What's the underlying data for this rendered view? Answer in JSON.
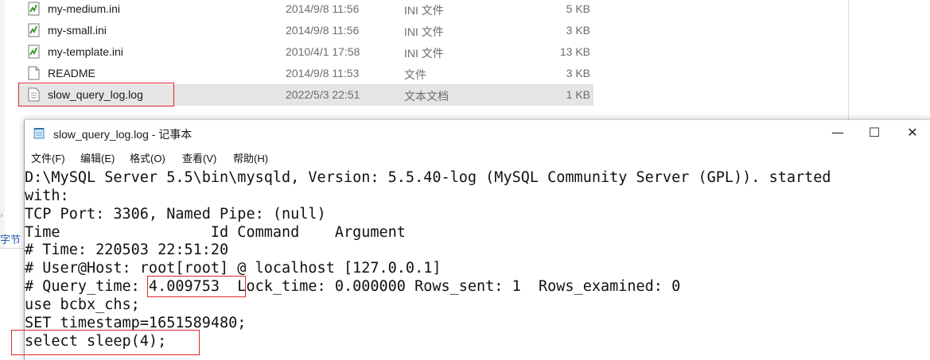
{
  "explorer": {
    "files": [
      {
        "name": "my-medium.ini",
        "date": "2014/9/8 11:56",
        "type": "INI 文件",
        "size": "5 KB",
        "icon": "ini-file-icon"
      },
      {
        "name": "my-small.ini",
        "date": "2014/9/8 11:56",
        "type": "INI 文件",
        "size": "3 KB",
        "icon": "ini-file-icon"
      },
      {
        "name": "my-template.ini",
        "date": "2010/4/1 17:58",
        "type": "INI 文件",
        "size": "13 KB",
        "icon": "ini-file-icon"
      },
      {
        "name": "README",
        "date": "2014/9/8 11:53",
        "type": "文件",
        "size": "3 KB",
        "icon": "file-icon"
      },
      {
        "name": "slow_query_log.log",
        "date": "2022/5/3 22:51",
        "type": "文本文档",
        "size": "1 KB",
        "icon": "text-file-icon"
      }
    ],
    "side_label": "字节"
  },
  "notepad": {
    "title": "slow_query_log.log - 记事本",
    "menu": [
      "文件(F)",
      "编辑(E)",
      "格式(O)",
      "查看(V)",
      "帮助(H)"
    ],
    "window_buttons": {
      "minimize": "—",
      "maximize": "☐",
      "close": "✕"
    },
    "lines": [
      "D:\\MySQL Server 5.5\\bin\\mysqld, Version: 5.5.40-log (MySQL Community Server (GPL)). started",
      "with:",
      "TCP Port: 3306, Named Pipe: (null)",
      "Time                 Id Command    Argument",
      "# Time: 220503 22:51:20",
      "# User@Host: root[root] @ localhost [127.0.0.1]",
      "# Query_time: 4.009753  Lock_time: 0.000000 Rows_sent: 1  Rows_examined: 0",
      "use bcbx_chs;",
      "SET timestamp=1651589480;",
      "select sleep(4);"
    ]
  },
  "colors": {
    "highlight": "#e0262d",
    "selected_row": "#e5e5e5"
  }
}
